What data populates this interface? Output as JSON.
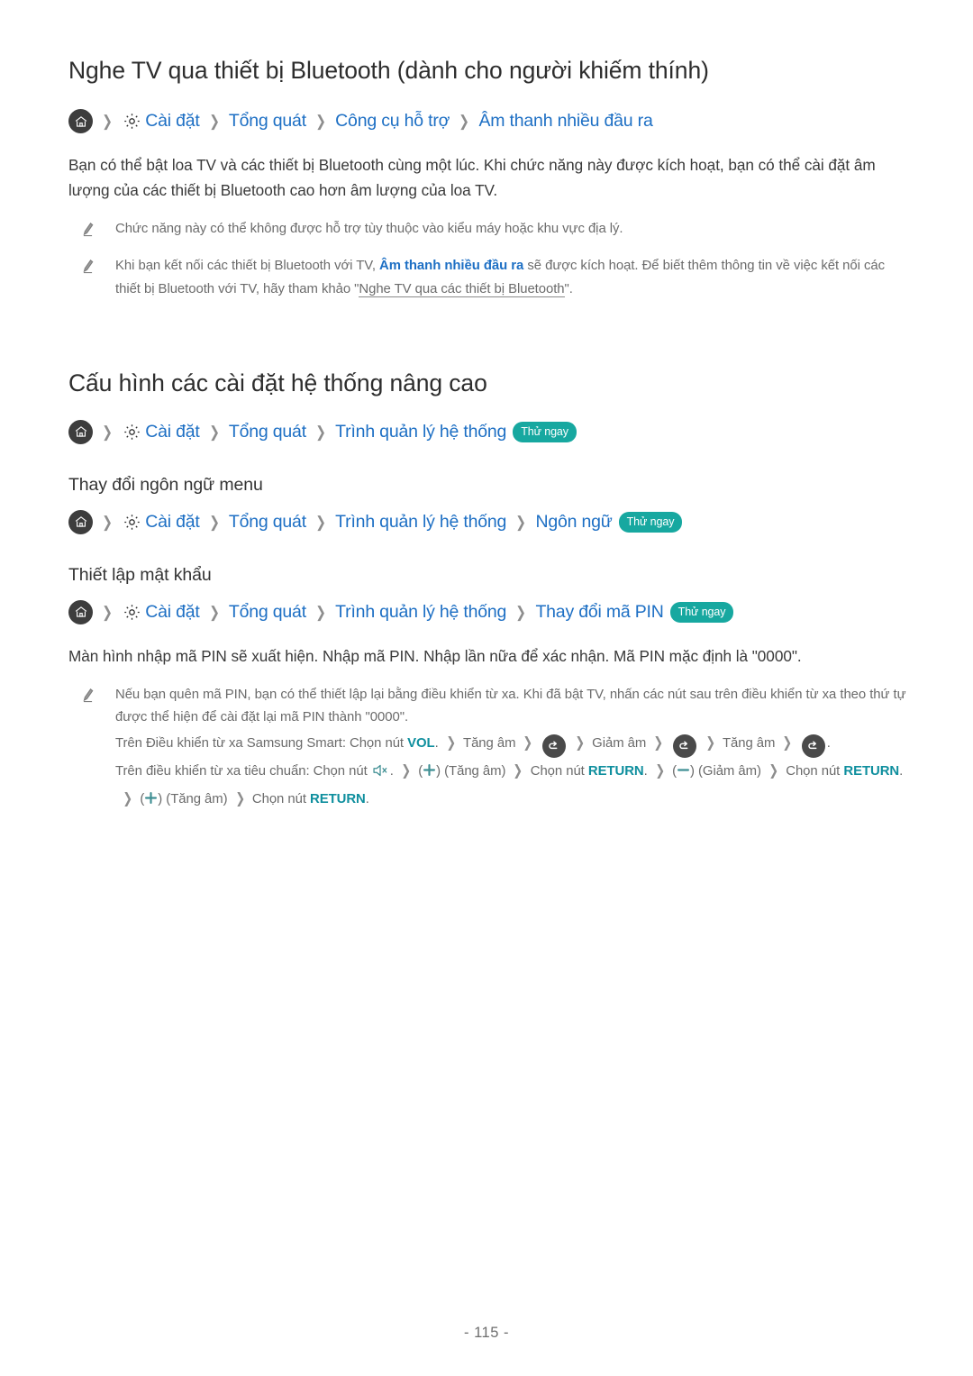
{
  "section1": {
    "title": "Nghe TV qua thiết bị Bluetooth (dành cho người khiếm thính)",
    "breadcrumb": {
      "home_icon": "home-icon",
      "gear_icon": "gear-icon",
      "items": [
        "Cài đặt",
        "Tổng quát",
        "Công cụ hỗ trợ",
        "Âm thanh nhiều đầu ra"
      ],
      "separator": "❯"
    },
    "paragraph": "Bạn có thể bật loa TV và các thiết bị Bluetooth cùng một lúc. Khi chức năng này được kích hoạt, bạn có thể cài đặt âm lượng của các thiết bị Bluetooth cao hơn âm lượng của loa TV.",
    "notes": [
      {
        "icon": "pencil-icon",
        "text": "Chức năng này có thể không được hỗ trợ tùy thuộc vào kiểu máy hoặc khu vực địa lý."
      },
      {
        "icon": "pencil-icon",
        "prefix": "Khi bạn kết nối các thiết bị Bluetooth với TV, ",
        "link": "Âm thanh nhiều đầu ra",
        "middle": " sẽ được kích hoạt. Để biết thêm thông tin về việc kết nối các thiết bị Bluetooth với TV, hãy tham khảo \"",
        "reference": "Nghe TV qua các thiết bị Bluetooth",
        "suffix": "\"."
      }
    ]
  },
  "section2": {
    "title": "Cấu hình các cài đặt hệ thống nâng cao",
    "breadcrumb": {
      "items": [
        "Cài đặt",
        "Tổng quát",
        "Trình quản lý hệ thống"
      ],
      "badge": "Thử ngay"
    },
    "sub1": {
      "title": "Thay đổi ngôn ngữ menu",
      "breadcrumb": {
        "items": [
          "Cài đặt",
          "Tổng quát",
          "Trình quản lý hệ thống",
          "Ngôn ngữ"
        ],
        "badge": "Thử ngay"
      }
    },
    "sub2": {
      "title": "Thiết lập mật khẩu",
      "breadcrumb": {
        "items": [
          "Cài đặt",
          "Tổng quát",
          "Trình quản lý hệ thống",
          "Thay đổi mã PIN"
        ],
        "badge": "Thử ngay"
      },
      "paragraph": "Màn hình nhập mã PIN sẽ xuất hiện. Nhập mã PIN. Nhập lần nữa để xác nhận. Mã PIN mặc định là \"0000\".",
      "note": {
        "icon": "pencil-icon",
        "text": "Nếu bạn quên mã PIN, bạn có thể thiết lập lại bằng điều khiển từ xa. Khi đã bật TV, nhấn các nút sau trên điều khiển từ xa theo thứ tự được thể hiện để cài đặt lại mã PIN thành \"0000\".",
        "smart_remote": {
          "lead": "Trên Điều khiển từ xa Samsung Smart: Chọn nút ",
          "vol_key": "VOL",
          "after_vol": ".",
          "steps": [
            "Tăng âm",
            "return-icon",
            "Giảm âm",
            "return-icon",
            "Tăng âm",
            "return-icon"
          ],
          "end": "."
        },
        "standard_remote": {
          "lead": "Trên điều khiển từ xa tiêu chuẩn: Chọn nút ",
          "mute_icon": "mute-icon",
          "after_mute": ".",
          "plus_label": "(Tăng âm)",
          "minus_label": "(Giảm âm)",
          "choose_label": "Chọn nút ",
          "return_key": "RETURN",
          "period": "."
        }
      }
    }
  },
  "footer": {
    "page_number": "- 115 -"
  },
  "colors": {
    "link_blue": "#1d6fc4",
    "badge_teal": "#17a8a0",
    "key_teal": "#0f8f9e",
    "icon_dark": "#3d3d3d",
    "note_gray": "#6b6b6b"
  }
}
